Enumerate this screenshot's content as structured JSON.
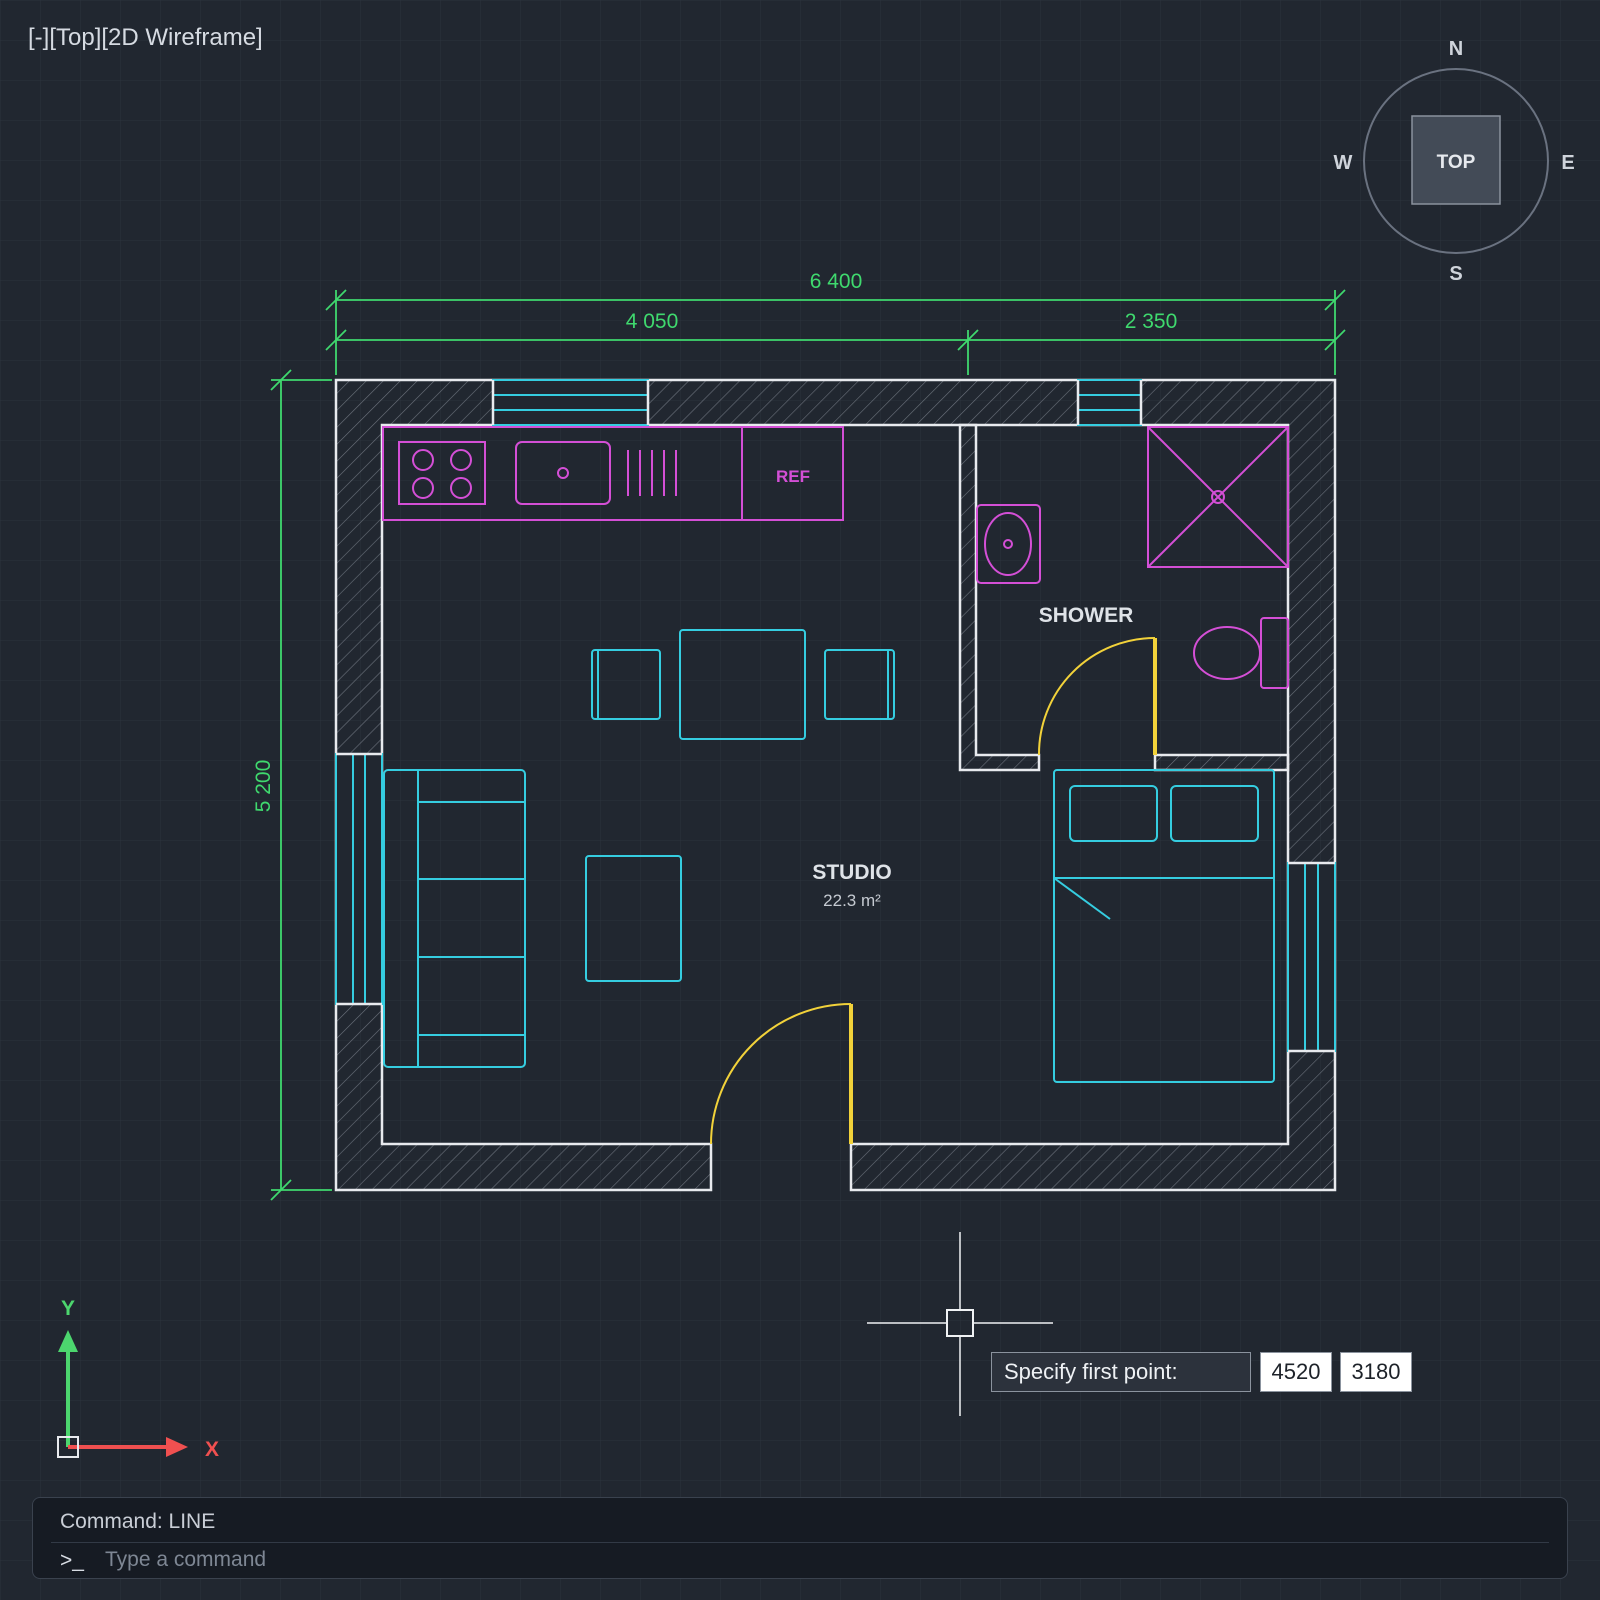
{
  "viewport": {
    "label": "[-][Top][2D Wireframe]"
  },
  "viewcube": {
    "face": "TOP",
    "north": "N",
    "south": "S",
    "east": "E",
    "west": "W"
  },
  "dimensions": {
    "overall_width": "6 400",
    "left_width": "4 050",
    "right_width": "2 350",
    "height": "5 200"
  },
  "rooms": {
    "studio": {
      "name": "STUDIO",
      "area": "22.3 m²"
    },
    "shower": {
      "name": "SHOWER"
    },
    "fridge_label": "REF"
  },
  "ucs": {
    "x_label": "X",
    "y_label": "Y"
  },
  "dynamic_input": {
    "prompt": "Specify first point:",
    "x": "4520",
    "y": "3180"
  },
  "command_line": {
    "history": "Command: LINE",
    "prompt_symbol": ">_",
    "placeholder": "Type a command"
  },
  "colors": {
    "background": "#212730",
    "wall": "#e8eaee",
    "window": "#35cde0",
    "furniture_cyan": "#35cde0",
    "furniture_magenta": "#d44fd6",
    "door": "#f2d23a",
    "dimension": "#3fd96e",
    "ucs_x": "#f05050",
    "ucs_y": "#4cd66e"
  }
}
